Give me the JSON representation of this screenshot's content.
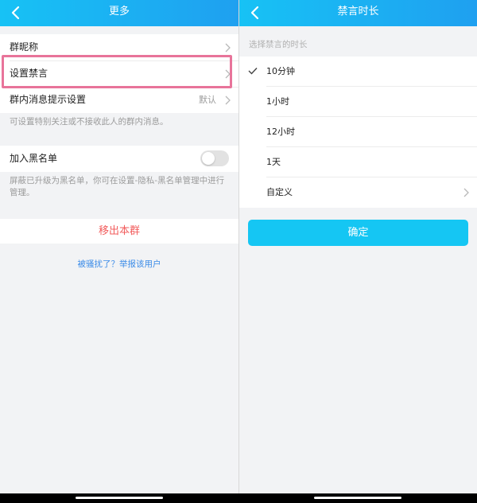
{
  "left": {
    "nav_title": "更多",
    "group_nickname_label": "群昵称",
    "mute_settings_label": "设置禁言",
    "message_notify_label": "群内消息提示设置",
    "message_notify_value": "默认",
    "message_notify_note": "可设置特别关注或不接收此人的群内消息。",
    "blacklist_label": "加入黑名单",
    "blacklist_enabled": false,
    "blacklist_note": "屏蔽已升级为黑名单，你可在设置-隐私-黑名单管理中进行管理。",
    "remove_label": "移出本群",
    "report_link": "被骚扰了？举报该用户"
  },
  "right": {
    "nav_title": "禁言时长",
    "hint": "选择禁言的时长",
    "options": [
      {
        "label": "10分钟",
        "selected": true
      },
      {
        "label": "1小时",
        "selected": false
      },
      {
        "label": "12小时",
        "selected": false
      },
      {
        "label": "1天",
        "selected": false
      },
      {
        "label": "自定义",
        "selected": false
      }
    ],
    "confirm_label": "确定"
  },
  "colors": {
    "nav_gradient_start": "#17c2f5",
    "nav_gradient_end": "#1fa0f0",
    "highlight_border": "#e8749a",
    "danger": "#f25c5c",
    "link": "#3b8be8",
    "confirm_button": "#15c6f3"
  },
  "icons": [
    "back-arrow-icon",
    "chevron-right-icon",
    "checkmark-icon"
  ]
}
